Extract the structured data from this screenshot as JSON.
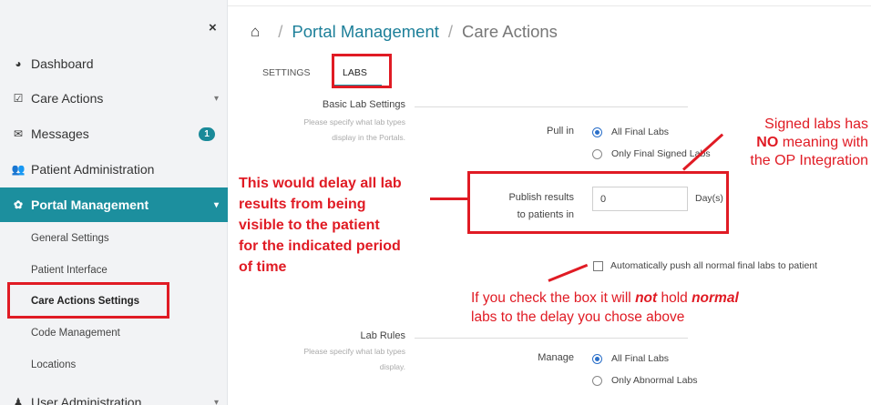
{
  "sidebar": {
    "close_glyph": "×",
    "items": [
      {
        "label": "Dashboard",
        "icon": "dashboard-icon",
        "glyph": "◕"
      },
      {
        "label": "Care Actions",
        "icon": "checkbox-icon",
        "glyph": "☑"
      },
      {
        "label": "Messages",
        "icon": "envelope-icon",
        "glyph": "✉",
        "badge": "1"
      },
      {
        "label": "Patient Administration",
        "icon": "users-icon",
        "glyph": "👥"
      },
      {
        "label": "Portal Management",
        "icon": "gear-icon",
        "glyph": "✿"
      },
      {
        "label": "User Administration",
        "icon": "user-icon",
        "glyph": "♟"
      }
    ],
    "sub_items": [
      "General Settings",
      "Patient Interface",
      "Care Actions Settings",
      "Code Management",
      "Locations"
    ]
  },
  "breadcrumb": {
    "home_icon": "home-icon",
    "home_glyph": "⌂",
    "separator": "/",
    "level1": "Portal Management",
    "level2": "Care Actions"
  },
  "tabs": {
    "settings": "SETTINGS",
    "labs": "LABS"
  },
  "basic_lab_settings": {
    "title": "Basic Lab Settings",
    "desc_line1": "Please specify what lab types",
    "desc_line2": "display in the Portals.",
    "pull_in_label": "Pull in",
    "pull_in_options": [
      "All Final Labs",
      "Only Final Signed Labs"
    ],
    "pull_in_selected": 0,
    "publish_label_line1": "Publish results",
    "publish_label_line2": "to patients in",
    "publish_value": "0",
    "publish_unit": "Day(s)",
    "auto_push_label": "Automatically push all normal final labs to patient",
    "auto_push_checked": false
  },
  "lab_rules": {
    "title": "Lab Rules",
    "desc_line1": "Please specify what lab types",
    "desc_line2": "display.",
    "manage_label": "Manage",
    "manage_options": [
      "All Final Labs",
      "Only Abnormal Labs"
    ],
    "manage_selected": 0
  },
  "annotations": {
    "signed_labs": {
      "line1": "Signed labs has",
      "line2_bold": "NO",
      "line2_rest": " meaning with",
      "line3": "the OP Integration"
    },
    "delay": {
      "line1": "This would delay all lab",
      "line2": "results from being",
      "line3": "visible to the patient",
      "line4": "for the indicated period",
      "line5": "of time"
    },
    "checkbox": {
      "l1_a": "If you check the box it will ",
      "l1_b": "not",
      "l1_c": " hold ",
      "l1_d": "normal",
      "l2": "labs to the delay you chose above"
    }
  },
  "colors": {
    "accent": "#1c8f9e",
    "annotation_red": "#e01b24",
    "radio_blue": "#2a6fc9"
  }
}
